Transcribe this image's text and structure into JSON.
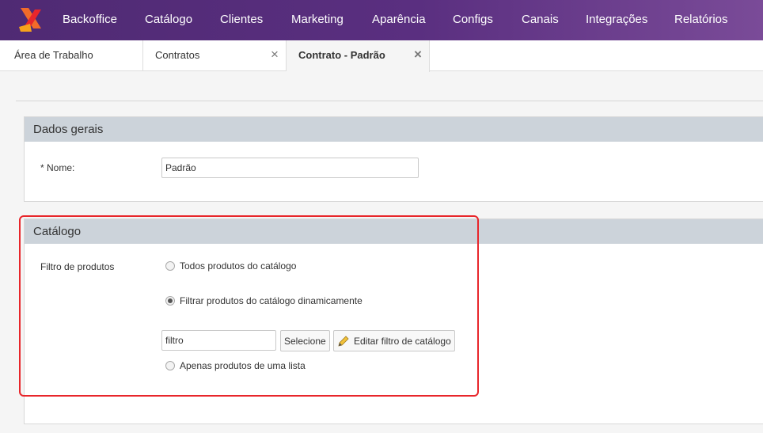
{
  "nav": {
    "items": [
      "Backoffice",
      "Catálogo",
      "Clientes",
      "Marketing",
      "Aparência",
      "Configs",
      "Canais",
      "Integrações",
      "Relatórios"
    ]
  },
  "tabs": [
    {
      "label": "Área de Trabalho"
    },
    {
      "label": "Contratos",
      "close": "×"
    },
    {
      "label": "Contrato - Padrão",
      "close": "×"
    }
  ],
  "dados_gerais": {
    "title": "Dados gerais",
    "nome_label": "* Nome:",
    "nome_value": "Padrão"
  },
  "catalogo": {
    "title": "Catálogo",
    "filtro_label": "Filtro de produtos",
    "options": [
      {
        "label": "Todos produtos do catálogo",
        "checked": false
      },
      {
        "label": "Filtrar produtos do catálogo dinamicamente",
        "checked": true
      },
      {
        "label": "Apenas produtos de uma lista",
        "checked": false
      }
    ],
    "filtro_value": "filtro",
    "selecione_label": "Selecione",
    "editar_label": "Editar filtro de catálogo"
  },
  "colors": {
    "nav_bg": "#5a2f80",
    "panel_header": "#ccd3da",
    "highlight": "#e8262b"
  }
}
